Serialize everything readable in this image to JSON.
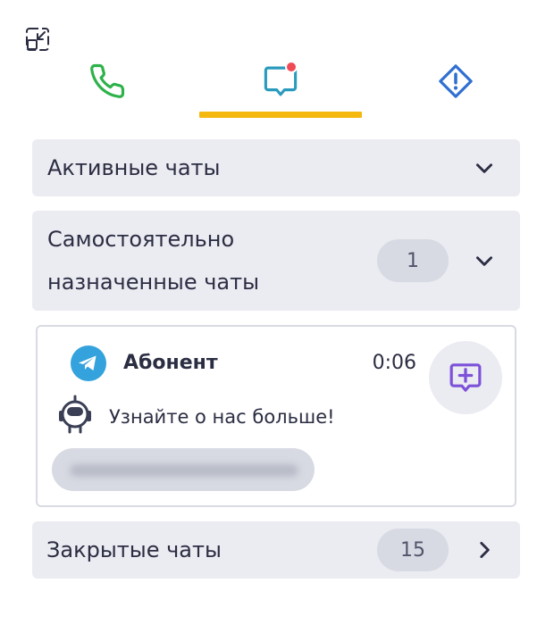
{
  "colors": {
    "phone": "#2db24a",
    "chat": "#2a9bbd",
    "alert": "#2f6fd1",
    "accent_tab": "#f5b80e",
    "badge": "#f04b55",
    "take": "#7d52d9",
    "telegram": "#34a2dc"
  },
  "icons": {
    "minimize": "minimize-icon",
    "phone": "phone-icon",
    "chat": "chat-bubble-icon",
    "alert": "warning-diamond-icon",
    "chevron_down": "chevron-down-icon",
    "chevron_right": "chevron-right-icon",
    "telegram": "telegram-icon",
    "bot": "robot-icon",
    "take_chat": "chat-plus-icon"
  },
  "tabs": {
    "selected": "chats",
    "chats_has_unread": true
  },
  "sections": {
    "active": {
      "title": "Активные чаты"
    },
    "self_assigned": {
      "title": "Самостоятельно назначенные чаты",
      "count": "1"
    },
    "closed": {
      "title": "Закрытые чаты",
      "count": "15"
    }
  },
  "chat": {
    "contact_name": "Абонент",
    "time": "0:06",
    "last_message": "Узнайте о нас больше!"
  }
}
